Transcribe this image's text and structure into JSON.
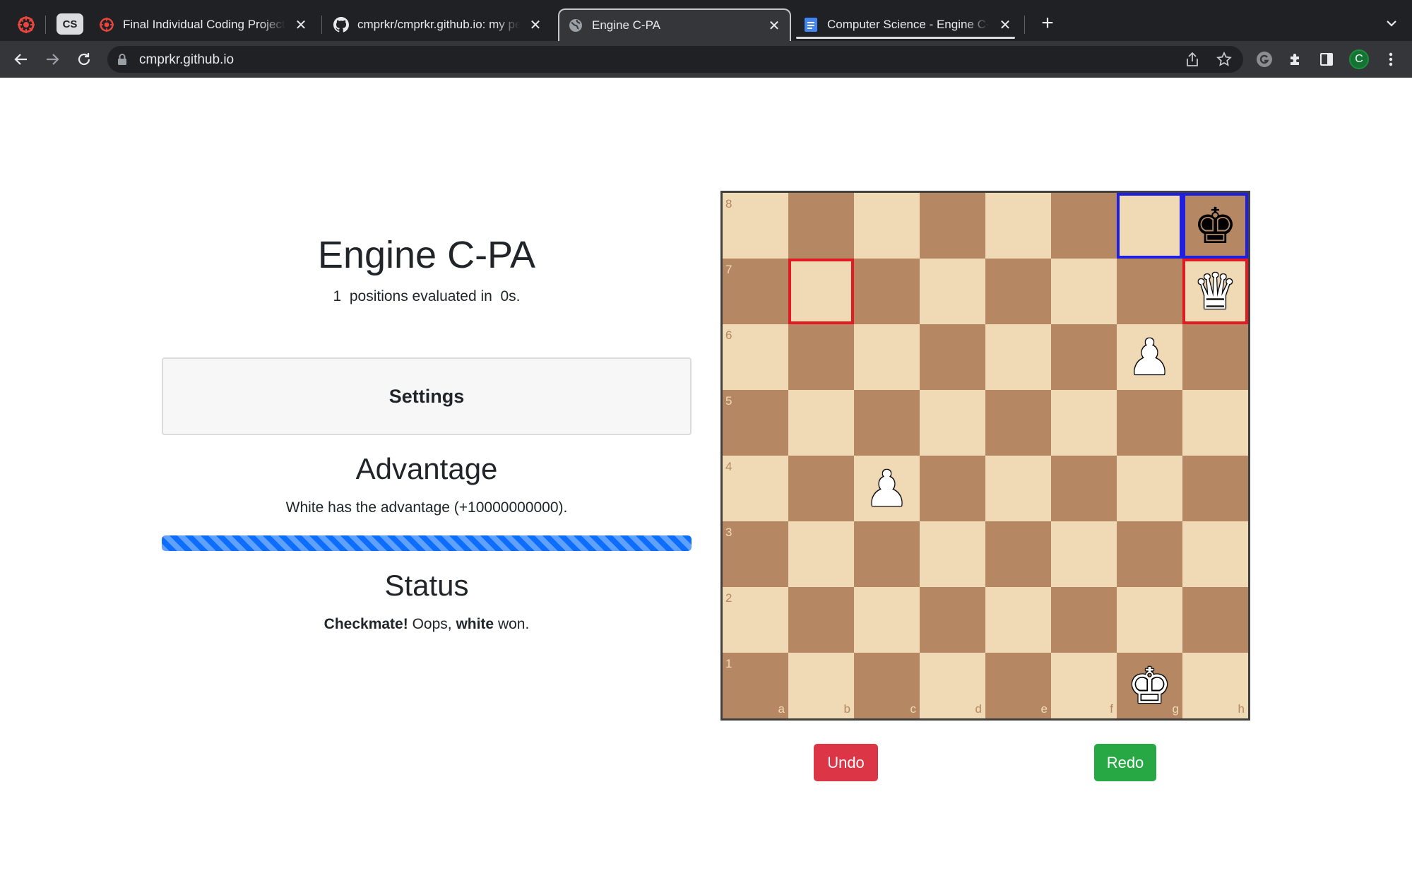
{
  "browser": {
    "tab_group_label": "CS",
    "tabs": [
      {
        "title": "Final Individual Coding Project: Engine C-PA",
        "icon": "college-logo-icon",
        "active": false
      },
      {
        "title": "cmprkr/cmprkr.github.io: my personal site",
        "icon": "github-icon",
        "active": false
      },
      {
        "title": "Engine C-PA",
        "icon": "globe-icon",
        "active": true
      },
      {
        "title": "Computer Science - Engine C-PA",
        "icon": "google-docs-icon",
        "active": false
      }
    ],
    "url": "cmprkr.github.io",
    "profile_initial": "C"
  },
  "page": {
    "title": "Engine C-PA",
    "eval_line": "1  positions evaluated in  0s.",
    "settings_label": "Settings",
    "advantage_heading": "Advantage",
    "advantage_text": "White has the advantage (+10000000000).",
    "advantage_fraction": 1.0,
    "status_heading": "Status",
    "status_bold_1": "Checkmate!",
    "status_mid": " Oops, ",
    "status_bold_2": "white",
    "status_end": " won."
  },
  "board": {
    "ranks": [
      "8",
      "7",
      "6",
      "5",
      "4",
      "3",
      "2",
      "1"
    ],
    "files": [
      "a",
      "b",
      "c",
      "d",
      "e",
      "f",
      "g",
      "h"
    ],
    "pieces": [
      {
        "square": "h8",
        "glyph": "♚",
        "color": "b",
        "name": "black-king-piece"
      },
      {
        "square": "h7",
        "glyph": "♛",
        "color": "w",
        "name": "white-queen-piece"
      },
      {
        "square": "g6",
        "glyph": "♟",
        "color": "w",
        "name": "white-pawn-piece"
      },
      {
        "square": "c4",
        "glyph": "♟",
        "color": "w",
        "name": "white-pawn-piece"
      },
      {
        "square": "g1",
        "glyph": "♚",
        "color": "w",
        "name": "white-king-piece"
      }
    ],
    "highlights": [
      {
        "square": "b7",
        "kind": "red"
      },
      {
        "square": "h7",
        "kind": "red"
      },
      {
        "square": "g8",
        "kind": "blue"
      },
      {
        "square": "h8",
        "kind": "blue"
      }
    ],
    "light_color": "#f0d9b5",
    "dark_color": "#b58863"
  },
  "controls": {
    "undo_label": "Undo",
    "redo_label": "Redo"
  }
}
